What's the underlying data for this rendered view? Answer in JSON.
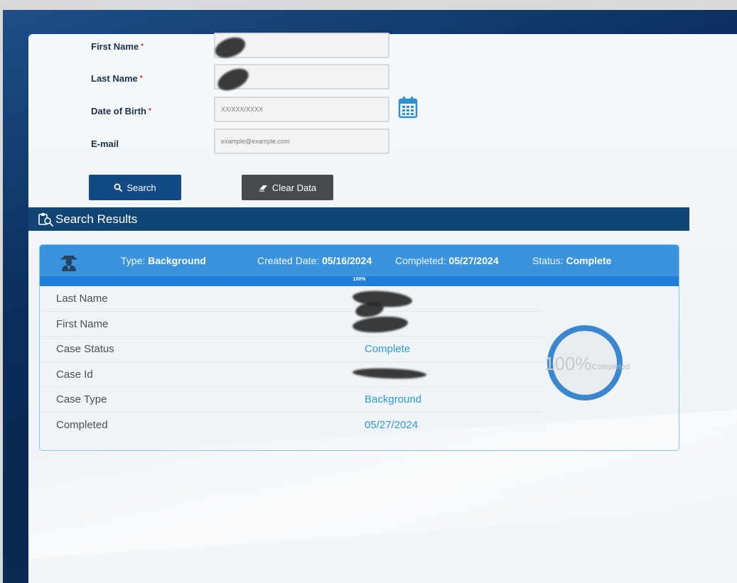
{
  "form": {
    "fields": [
      {
        "label": "First Name",
        "required": true,
        "value": "",
        "placeholder": ""
      },
      {
        "label": "Last Name",
        "required": true,
        "value": "",
        "placeholder": ""
      },
      {
        "label": "Date of Birth",
        "required": true,
        "value": "",
        "placeholder": "XX/XXX/XXXX"
      },
      {
        "label": "E-mail",
        "required": false,
        "value": "",
        "placeholder": "example@example.com"
      }
    ],
    "required_mark": "*",
    "calendar_icon": "calendar-icon",
    "search_label": "Search",
    "search_icon": "search-icon",
    "clear_label": "Clear Data",
    "clear_icon": "eraser-icon"
  },
  "results": {
    "title": "Search Results",
    "title_icon": "clipboard-search-icon",
    "card": {
      "icon": "spy-agent-icon",
      "type_label": "Type:",
      "type_value": "Background",
      "created_label": "Created Date:",
      "created_value": "05/16/2024",
      "completed_label": "Completed:",
      "completed_value": "05/27/2024",
      "status_label": "Status:",
      "status_value": "Complete",
      "progress": 1.0,
      "progress_text": "100%",
      "rows": [
        {
          "key": "Last Name",
          "value": ""
        },
        {
          "key": "First Name",
          "value": ""
        },
        {
          "key": "Case Status",
          "value": "Complete"
        },
        {
          "key": "Case Id",
          "value": ""
        },
        {
          "key": "Case Type",
          "value": "Background"
        },
        {
          "key": "Completed",
          "value": "05/27/2024"
        }
      ],
      "donut_percent": "100%",
      "donut_label": "Completed",
      "donut_value": 1.0
    }
  },
  "colors": {
    "primary": "#134a86",
    "header_blue": "#3a93dc",
    "value_blue": "#2e9ad6",
    "required_red": "#d0312d",
    "clear_button": "#474b4f"
  }
}
